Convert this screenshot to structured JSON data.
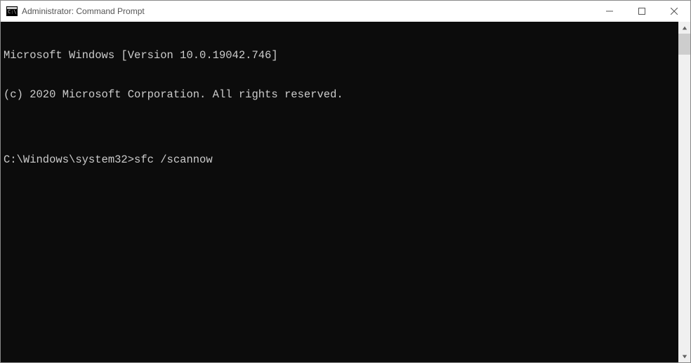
{
  "window": {
    "title": "Administrator: Command Prompt"
  },
  "terminal": {
    "line1": "Microsoft Windows [Version 10.0.19042.746]",
    "line2": "(c) 2020 Microsoft Corporation. All rights reserved.",
    "blank": "",
    "prompt": "C:\\Windows\\system32>",
    "command": "sfc /scannow"
  }
}
